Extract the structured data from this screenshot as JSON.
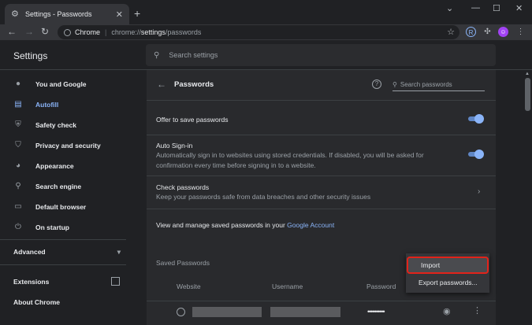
{
  "tab": {
    "title": "Settings - Passwords",
    "icon": "gear-icon"
  },
  "window_controls": [
    "minimize-icon",
    "maximize-icon",
    "close-icon"
  ],
  "omnibox": {
    "chip": "Chrome",
    "scheme": "chrome://",
    "host": "settings",
    "path": "/passwords"
  },
  "header": {
    "title": "Settings",
    "search_placeholder": "Search settings"
  },
  "sidebar": {
    "items": [
      {
        "label": "You and Google",
        "icon": "person-icon",
        "active": false
      },
      {
        "label": "Autofill",
        "icon": "clipboard-icon",
        "active": true
      },
      {
        "label": "Safety check",
        "icon": "shield-icon",
        "active": false
      },
      {
        "label": "Privacy and security",
        "icon": "shield-icon",
        "active": false
      },
      {
        "label": "Appearance",
        "icon": "palette-icon",
        "active": false
      },
      {
        "label": "Search engine",
        "icon": "search-icon",
        "active": false
      },
      {
        "label": "Default browser",
        "icon": "browser-icon",
        "active": false
      },
      {
        "label": "On startup",
        "icon": "power-icon",
        "active": false
      }
    ],
    "advanced": "Advanced",
    "extensions": "Extensions",
    "about": "About Chrome"
  },
  "passwords": {
    "title": "Passwords",
    "search_placeholder": "Search passwords",
    "offer_to_save": "Offer to save passwords",
    "auto_signin_title": "Auto Sign-in",
    "auto_signin_desc": "Automatically sign in to websites using stored credentials. If disabled, you will be asked for confirmation every time before signing in to a website.",
    "check_title": "Check passwords",
    "check_desc": "Keep your passwords safe from data breaches and other security issues",
    "manage_prefix": "View and manage saved passwords in your ",
    "manage_link": "Google Account",
    "saved_title": "Saved Passwords",
    "columns": [
      "Website",
      "Username",
      "Password"
    ],
    "masked_password": "••••••••••"
  },
  "menu": {
    "items": [
      "Import",
      "Export passwords..."
    ]
  },
  "colors": {
    "accent": "#8ab4f8",
    "highlight_border": "#e2231a",
    "background": "#202124",
    "card": "#292a2d"
  }
}
